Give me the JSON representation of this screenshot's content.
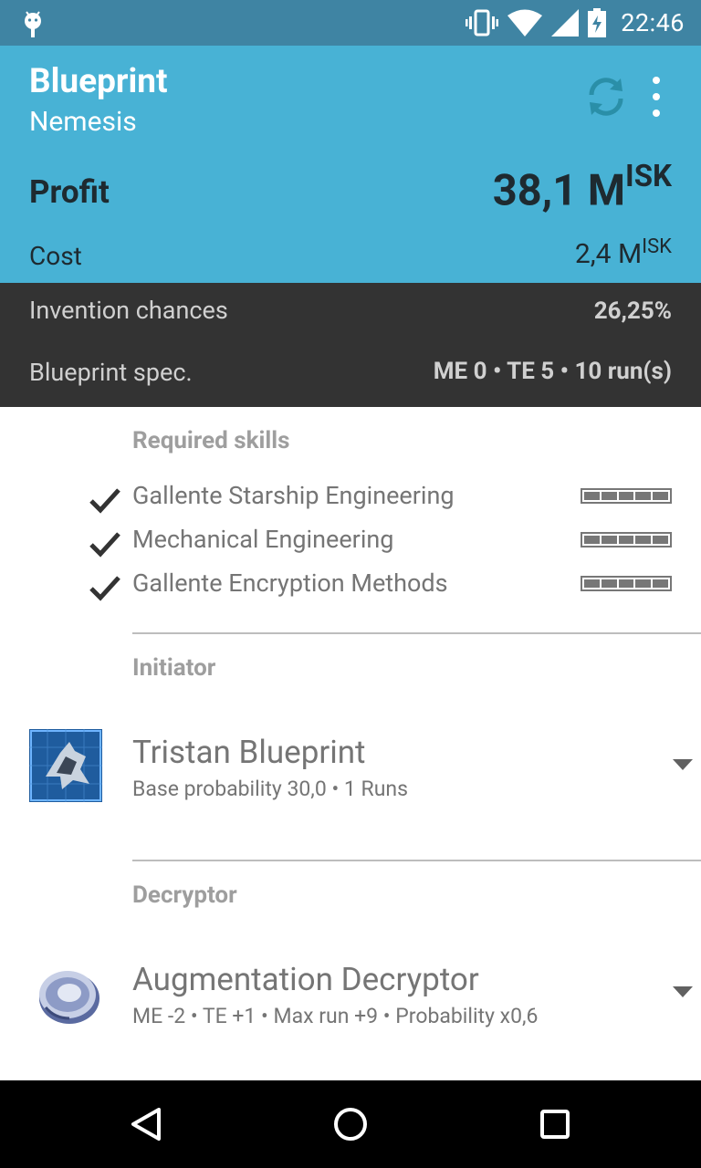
{
  "status_bar": {
    "time": "22:46",
    "icons": [
      "android-debug-icon",
      "vibrate-icon",
      "wifi-icon",
      "signal-icon",
      "battery-charging-icon"
    ]
  },
  "app_bar": {
    "title": "Blueprint",
    "subtitle": "Nemesis",
    "actions": [
      "refresh-icon",
      "more-options-icon"
    ]
  },
  "summary": {
    "profit_label": "Profit",
    "profit_value": "38,1 M",
    "profit_unit": "ISK",
    "cost_label": "Cost",
    "cost_value": "2,4 M",
    "cost_unit": "ISK"
  },
  "details": {
    "invention_label": "Invention chances",
    "invention_value": "26,25%",
    "spec_label": "Blueprint spec.",
    "spec_value": "ME 0 • TE 5 • 10 run(s)"
  },
  "required_skills": {
    "header": "Required skills",
    "items": [
      {
        "name": "Gallente Starship Engineering",
        "level": 5,
        "max_level": 5
      },
      {
        "name": "Mechanical Engineering",
        "level": 5,
        "max_level": 5
      },
      {
        "name": "Gallente Encryption Methods",
        "level": 5,
        "max_level": 5
      }
    ]
  },
  "initiator": {
    "header": "Initiator",
    "title": "Tristan Blueprint",
    "subtitle": "Base probability 30,0 • 1 Runs"
  },
  "decryptor": {
    "header": "Decryptor",
    "title": "Augmentation Decryptor",
    "subtitle": "ME -2 • TE +1 • Max run +9 • Probability x0,6"
  },
  "colors": {
    "status_bar": "#3f84a3",
    "app_bar": "#48b2d5",
    "dark_band": "#333333",
    "nav_bar": "#000000"
  },
  "nav_bar": [
    "back-icon",
    "home-icon",
    "recents-icon"
  ]
}
